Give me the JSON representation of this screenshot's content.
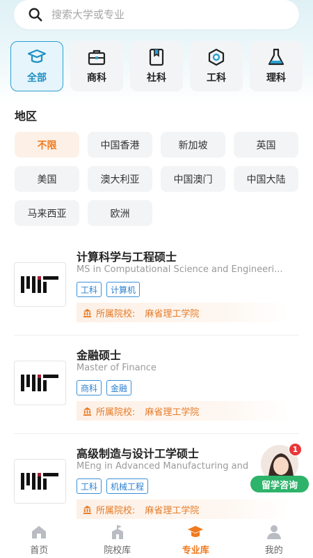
{
  "search": {
    "placeholder": "搜索大学或专业",
    "icon": "search-icon"
  },
  "categories": [
    {
      "label": "全部",
      "icon": "graduation-cap-icon",
      "active": true
    },
    {
      "label": "商科",
      "icon": "briefcase-icon",
      "active": false
    },
    {
      "label": "社科",
      "icon": "book-icon",
      "active": false
    },
    {
      "label": "工科",
      "icon": "hex-nut-icon",
      "active": false
    },
    {
      "label": "理科",
      "icon": "flask-icon",
      "active": false
    }
  ],
  "region": {
    "title": "地区",
    "options": [
      "不限",
      "中国香港",
      "新加坡",
      "英国",
      "美国",
      "澳大利亚",
      "中国澳门",
      "中国大陆",
      "马来西亚",
      "欧洲"
    ],
    "selected": "不限"
  },
  "programs": [
    {
      "title": "计算科学与工程硕士",
      "subtitle": "MS in Computational Science and Engineeri...",
      "tags": [
        "工科",
        "计算机"
      ],
      "school_label": "所属院校:",
      "school": "麻省理工学院",
      "logo_text": "MIT"
    },
    {
      "title": "金融硕士",
      "subtitle": "Master of Finance",
      "tags": [
        "商科",
        "金融"
      ],
      "school_label": "所属院校:",
      "school": "麻省理工学院",
      "logo_text": "MIT"
    },
    {
      "title": "高级制造与设计工学硕士",
      "subtitle": "MEng in Advanced Manufacturing and",
      "tags": [
        "工科",
        "机械工程"
      ],
      "school_label": "所属院校:",
      "school": "麻省理工学院",
      "logo_text": "MIT"
    }
  ],
  "consult": {
    "label": "留学咨询",
    "badge": "1"
  },
  "tabbar": [
    {
      "label": "首页",
      "icon": "home-icon",
      "active": false
    },
    {
      "label": "院校库",
      "icon": "school-building-icon",
      "active": false
    },
    {
      "label": "专业库",
      "icon": "graduation-cap-icon",
      "active": true
    },
    {
      "label": "我的",
      "icon": "user-icon",
      "active": false
    }
  ],
  "colors": {
    "accent": "#2a9fd0",
    "orange": "#f07a1e",
    "green": "#2db36a",
    "tag_blue": "#3a8fd8"
  }
}
